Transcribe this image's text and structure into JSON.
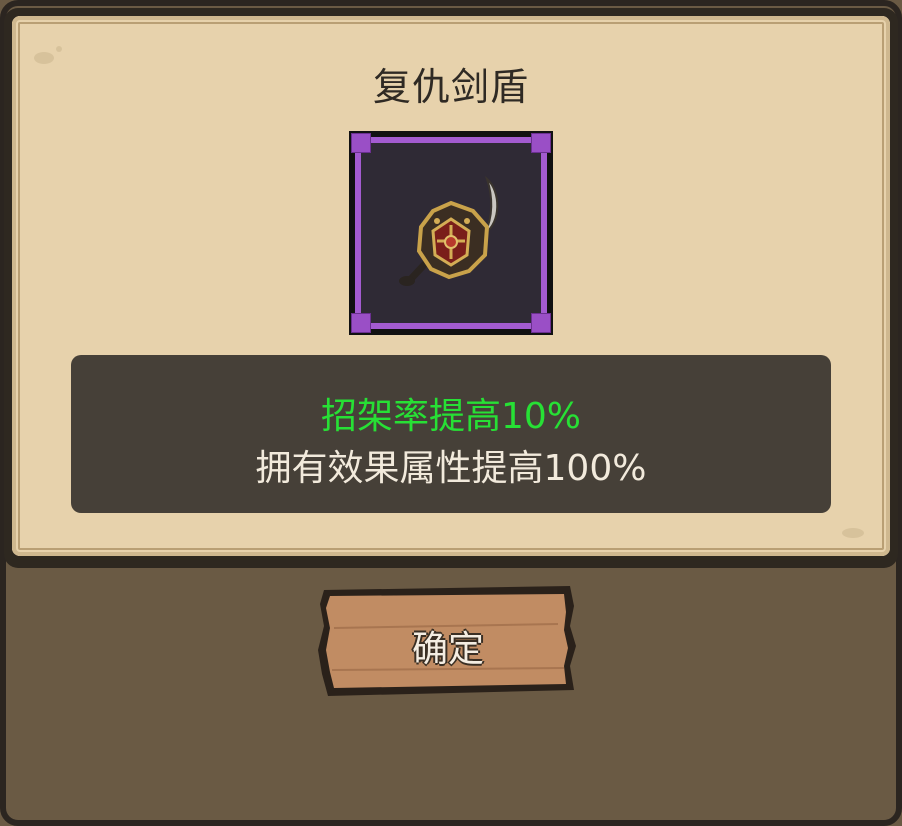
{
  "dialog": {
    "title": "复仇剑盾",
    "item_icon": "sword-shield-icon",
    "rarity_color": "#a35bd0",
    "effects": {
      "primary": "招架率提高10%",
      "primary_color": "#27e035",
      "secondary": "拥有效果属性提高100%"
    },
    "confirm_label": "确定"
  }
}
